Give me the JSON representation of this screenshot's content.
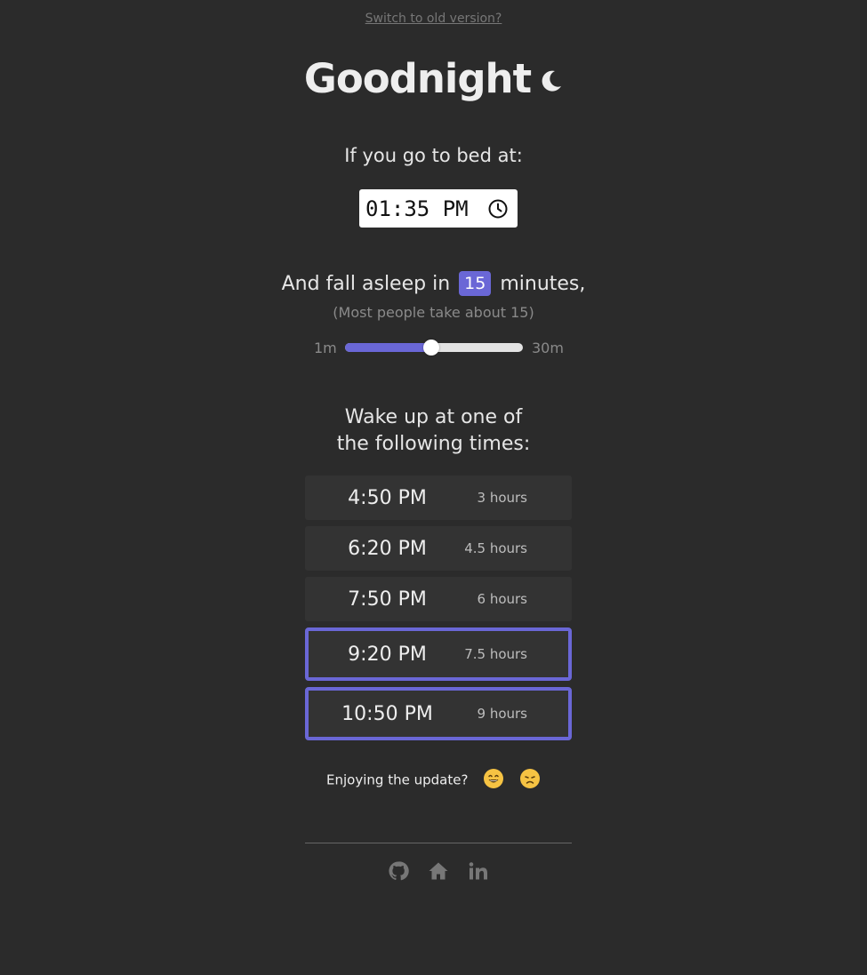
{
  "header": {
    "old_version_link": "Switch to old version?",
    "title": "Goodnight",
    "title_icon": "moon-icon"
  },
  "bedtime": {
    "label": "If you go to bed at:",
    "value": "01:35 PM",
    "icon": "clock-icon"
  },
  "sleep_latency": {
    "prefix": "And fall asleep in",
    "minutes": "15",
    "suffix": "minutes,",
    "hint": "(Most people take about 15)",
    "slider_min": "1m",
    "slider_max": "30m",
    "slider_value": 15,
    "slider_range": [
      1,
      30
    ],
    "accent_color": "#6a67d6"
  },
  "wake": {
    "heading_line1": "Wake up at one of",
    "heading_line2": "the following times:",
    "times": [
      {
        "time": "4:50 PM",
        "duration": "3 hours",
        "highlighted": false
      },
      {
        "time": "6:20 PM",
        "duration": "4.5 hours",
        "highlighted": false
      },
      {
        "time": "7:50 PM",
        "duration": "6 hours",
        "highlighted": false
      },
      {
        "time": "9:20 PM",
        "duration": "7.5 hours",
        "highlighted": true
      },
      {
        "time": "10:50 PM",
        "duration": "9 hours",
        "highlighted": true
      }
    ]
  },
  "feedback": {
    "question": "Enjoying the update?",
    "positive_icon": "smile-emoji-icon",
    "negative_icon": "disappointed-emoji-icon"
  },
  "footer": {
    "icons": [
      "github-icon",
      "home-icon",
      "linkedin-icon"
    ]
  }
}
